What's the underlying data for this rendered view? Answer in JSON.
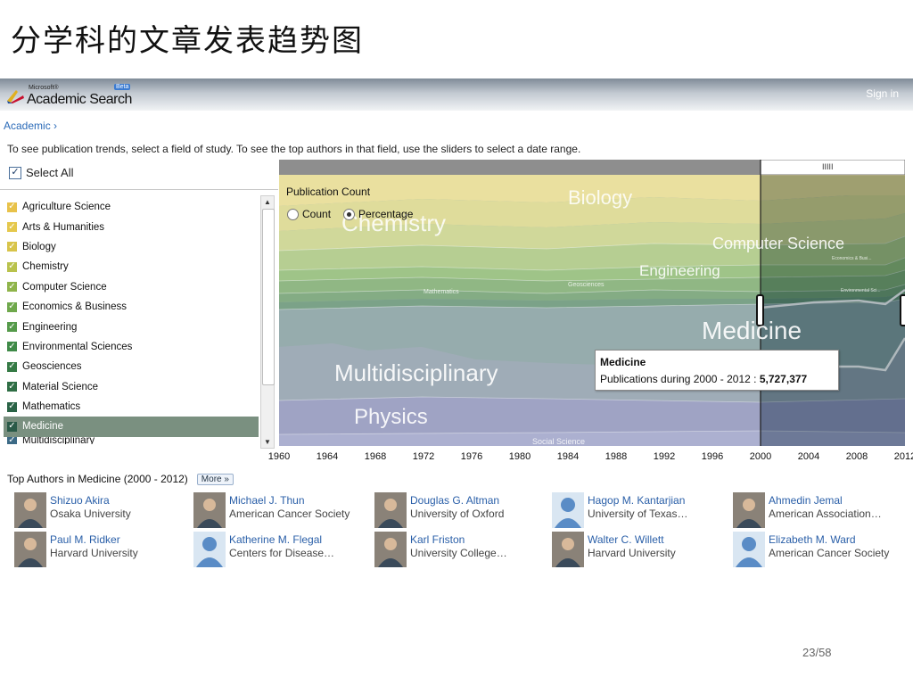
{
  "slide": {
    "title": "分学科的文章发表趋势图",
    "page": "23/58"
  },
  "app": {
    "brand_small": "Microsoft®",
    "brand": "Academic Search",
    "beta": "Beta",
    "signin": "Sign in"
  },
  "breadcrumb": "Academic",
  "instructions": "To see publication trends, select a field of study. To see the top authors in that field, use the sliders to select a date range.",
  "select_all": "Select All",
  "fields": [
    {
      "label": "Agriculture Science",
      "color": "#e8c24a"
    },
    {
      "label": "Arts & Humanities",
      "color": "#e5c84d"
    },
    {
      "label": "Biology",
      "color": "#d8c44a"
    },
    {
      "label": "Chemistry",
      "color": "#b9c24c"
    },
    {
      "label": "Computer Science",
      "color": "#8fb44a"
    },
    {
      "label": "Economics & Business",
      "color": "#6fa84c"
    },
    {
      "label": "Engineering",
      "color": "#559a4a"
    },
    {
      "label": "Environmental Sciences",
      "color": "#3f8a48"
    },
    {
      "label": "Geosciences",
      "color": "#357a45"
    },
    {
      "label": "Material Science",
      "color": "#2f6e45"
    },
    {
      "label": "Mathematics",
      "color": "#2a6346"
    },
    {
      "label": "Medicine",
      "color": "#2a5a48",
      "selected": true
    },
    {
      "label": "Multidisciplinary",
      "color": "#3c6a86"
    }
  ],
  "chart": {
    "title": "Publication Count",
    "modes": [
      "Count",
      "Percentage"
    ],
    "selected_mode": "Percentage",
    "slider_handle": "IIIII",
    "tooltip": {
      "field": "Medicine",
      "prefix": "Publications during",
      "range": "2000 - 2012",
      "value": "5,727,377"
    }
  },
  "chart_data": {
    "type": "area",
    "x": [
      1960,
      1964,
      1968,
      1972,
      1976,
      1980,
      1984,
      1988,
      1992,
      1996,
      2000,
      2004,
      2008,
      2012
    ],
    "xlim": [
      1960,
      2012
    ],
    "tick_labels": [
      "1960",
      "1964",
      "1968",
      "1972",
      "1976",
      "1980",
      "1984",
      "1988",
      "1992",
      "1996",
      "2000",
      "2004",
      "2008",
      "2012"
    ],
    "selected_range": [
      2000,
      2012
    ],
    "stream_labels": [
      "Biology",
      "Chemistry",
      "Computer Science",
      "Engineering",
      "Mathematics",
      "Geosciences",
      "Medicine",
      "Multidisciplinary",
      "Physics",
      "Social Science"
    ],
    "tiny_labels": [
      "Economics & Busi...",
      "Environmental Sci..."
    ]
  },
  "top_authors": {
    "heading": "Top Authors in Medicine (2000 - 2012)",
    "more": "More",
    "list": [
      {
        "name": "Shizuo  Akira",
        "affiliation": "Osaka University",
        "photo": "person"
      },
      {
        "name": "Michael J. Thun",
        "affiliation": "American Cancer Society",
        "photo": "person"
      },
      {
        "name": "Douglas G. Altman",
        "affiliation": "University of Oxford",
        "photo": "person"
      },
      {
        "name": "Hagop M. Kantarjian",
        "affiliation": "University of Texas…",
        "photo": "placeholder"
      },
      {
        "name": "Ahmedin  Jemal",
        "affiliation": "American Association…",
        "photo": "person"
      },
      {
        "name": "Paul M. Ridker",
        "affiliation": "Harvard University",
        "photo": "person"
      },
      {
        "name": "Katherine M. Flegal",
        "affiliation": "Centers for Disease…",
        "photo": "placeholder"
      },
      {
        "name": "Karl  Friston",
        "affiliation": "University College…",
        "photo": "person"
      },
      {
        "name": "Walter C. Willett",
        "affiliation": "Harvard University",
        "photo": "person"
      },
      {
        "name": "Elizabeth M. Ward",
        "affiliation": "American Cancer Society",
        "photo": "placeholder"
      }
    ]
  }
}
